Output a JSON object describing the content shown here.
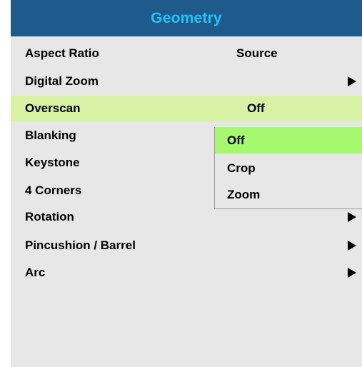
{
  "menu": {
    "title": "Geometry",
    "items": [
      {
        "label": "Aspect Ratio",
        "value": "Source",
        "submenu": false
      },
      {
        "label": "Digital Zoom",
        "value": "",
        "submenu": true
      },
      {
        "label": "Overscan",
        "value": "Off",
        "submenu": false,
        "selected": true
      },
      {
        "label": "Blanking",
        "value": "",
        "submenu": false
      },
      {
        "label": "Keystone",
        "value": "",
        "submenu": false
      },
      {
        "label": "4 Corners",
        "value": "",
        "submenu": false
      },
      {
        "label": "Rotation",
        "value": "",
        "submenu": true
      },
      {
        "label": "Pincushion / Barrel",
        "value": "",
        "submenu": true
      },
      {
        "label": "Arc",
        "value": "",
        "submenu": true
      }
    ]
  },
  "dropdown": {
    "options": [
      "Off",
      "Crop",
      "Zoom"
    ],
    "active": "Off"
  },
  "icons": {
    "submenu": "triangle-right-icon"
  },
  "colors": {
    "title_bg": "#1e5a8c",
    "title_text": "#22c6f4",
    "menu_bg": "#e7e7e7",
    "selected_row": "#d7f2a4",
    "active_option": "#a6f86f"
  }
}
